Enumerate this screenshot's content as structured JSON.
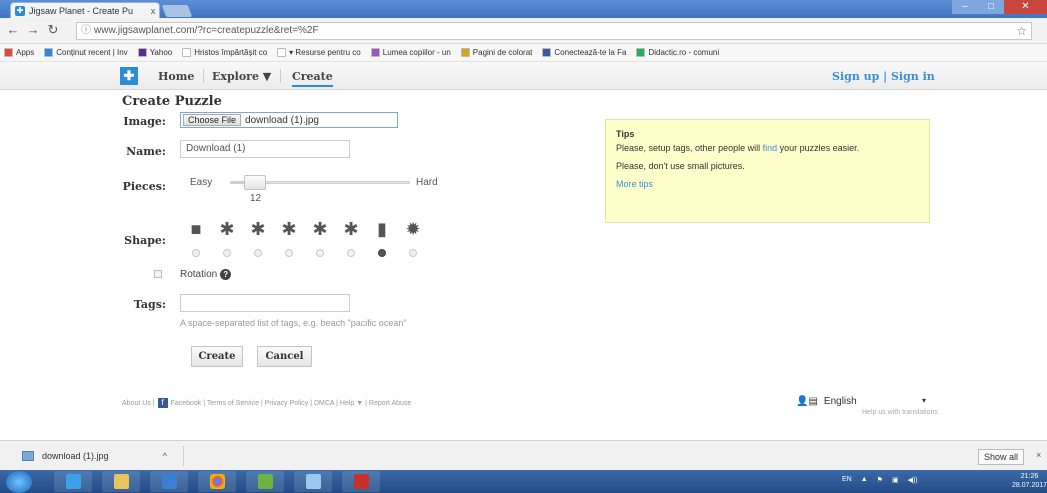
{
  "browser": {
    "tab_title": "Jigsaw Planet - Create Pu",
    "tab_close": "x",
    "url": "www.jigsawplanet.com/?rc=createpuzzle&ret=%2F",
    "bookmarks": [
      {
        "label": "Apps",
        "color": "#e04b3b"
      },
      {
        "label": "Conținut recent | Inv",
        "color": "#2f8ad6"
      },
      {
        "label": "Yahoo",
        "color": "#5b2d91"
      },
      {
        "label": "Hristos împărtășit co",
        "color": "#ffffff"
      },
      {
        "label": "▾ Resurse pentru co",
        "color": "#ffffff"
      },
      {
        "label": "Lumea copiilor - un",
        "color": "#9b59b6"
      },
      {
        "label": "Pagini de colorat",
        "color": "#d9a21b"
      },
      {
        "label": "Conectează-te la Fa",
        "color": "#3b5998"
      },
      {
        "label": "Didactic.ro - comuni",
        "color": "#27ae60"
      }
    ]
  },
  "site": {
    "nav": {
      "home": "Home",
      "explore": "Explore ▼",
      "create": "Create"
    },
    "auth": "Sign up | Sign in"
  },
  "form": {
    "title": "Create Puzzle",
    "image_label": "Image:",
    "choose_file": "Choose File",
    "file_name": "download (1).jpg",
    "name_label": "Name:",
    "name_value": "Download (1)",
    "pieces_label": "Pieces:",
    "easy": "Easy",
    "hard": "Hard",
    "pieces_value": "12",
    "pieces_level": 0.08,
    "shape_label": "Shape:",
    "shapes": [
      "■",
      "✱",
      "✱",
      "✱",
      "✱",
      "✱",
      "▮",
      "✹"
    ],
    "selected_shape_index": 6,
    "rotation_label": "Rotation",
    "tags_label": "Tags:",
    "tags_value": "",
    "tags_hint": "A space-separated list of tags, e.g. beach \"pacific ocean\"",
    "create_button": "Create",
    "cancel_button": "Cancel"
  },
  "tips": {
    "title": "Tips",
    "tip1_a": "Please, setup tags, other people will ",
    "tip1_link": "find",
    "tip1_b": " your puzzles easier.",
    "tip2": "Please, don't use small pictures.",
    "more": "More tips"
  },
  "footer": {
    "about": "About Us |",
    "fb": "f",
    "links": "Facebook | Terms of Service | Privacy Policy | DMCA | Help ▼ | Report Abuse",
    "language": "English",
    "lang_arrow": "▾",
    "lang_help": "Help us with translations"
  },
  "downloads": {
    "file": "download (1).jpg",
    "chevron": "^",
    "show_all": "Show all",
    "close": "×"
  },
  "taskbar": {
    "tray": [
      "EN",
      "▲",
      "⚑",
      "▣",
      "◀))"
    ],
    "time": "21:26",
    "date": "28.07.2017"
  },
  "colors": {
    "accent": "#2b8cd8",
    "tips_bg": "#ffffcc",
    "link": "#3a8fd8"
  }
}
